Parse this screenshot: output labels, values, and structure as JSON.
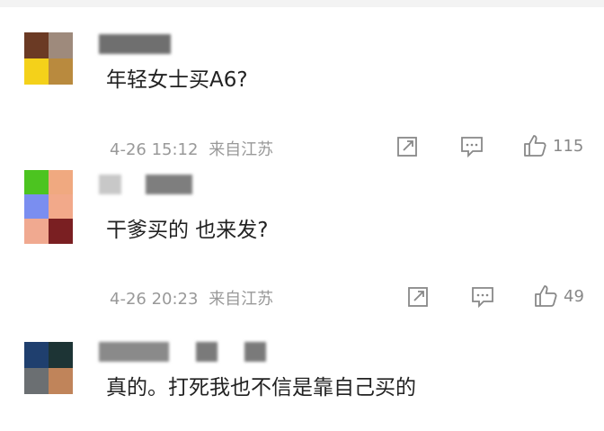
{
  "comments": [
    {
      "text": "年轻女士买A6?",
      "time": "4-26 15:12",
      "location": "来自江苏",
      "likes": "115",
      "icons": [
        "share-icon",
        "comment-icon",
        "thumbs-up-icon"
      ]
    },
    {
      "text": "干爹买的 也来发?",
      "time": "4-26 20:23",
      "location": "来自江苏",
      "likes": "49",
      "icons": [
        "share-icon",
        "comment-icon",
        "thumbs-up-icon"
      ]
    },
    {
      "text": "真的。打死我也不信是靠自己买的"
    }
  ],
  "colors": {
    "text": "#222222",
    "meta": "#999999",
    "icon": "#888888"
  }
}
